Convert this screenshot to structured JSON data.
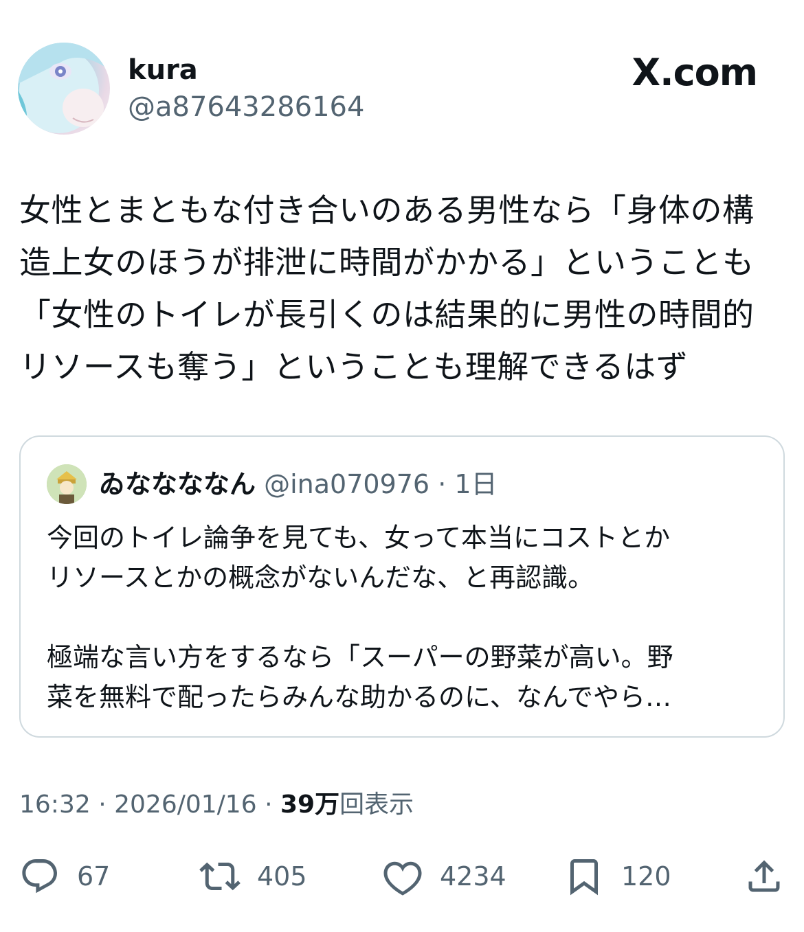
{
  "header": {
    "display_name": "kura",
    "handle": "@a87643286164",
    "site_logo": "X.com"
  },
  "tweet": {
    "text": "女性とまともな付き合いのある男性なら「身体の構\n造上女のほうが排泄に時間がかかる」ということも\n「女性のトイレが長引くのは結果的に男性の時間的\nリソースも奪う」ということも理解できるはず"
  },
  "quote": {
    "display_name": "ゐななななん",
    "handle": "@ina070976",
    "time_ago": "1日",
    "separator": "·",
    "text": "今回のトイレ論争を見ても、女って本当にコストとか\nリソースとかの概念がないんだな、と再認識。\n\n極端な言い方をするなら「スーパーの野菜が高い。野\n菜を無料で配ったらみんな助かるのに、なんでやら…"
  },
  "meta": {
    "time": "16:32",
    "date": "2026/01/16",
    "separator": "·",
    "views_count": "39万",
    "views_label": "回表示"
  },
  "actions": {
    "replies": "67",
    "retweets": "405",
    "likes": "4234",
    "bookmarks": "120"
  },
  "icons": {
    "reply": "reply-icon",
    "retweet": "retweet-icon",
    "like": "heart-icon",
    "bookmark": "bookmark-icon",
    "share": "share-icon"
  }
}
